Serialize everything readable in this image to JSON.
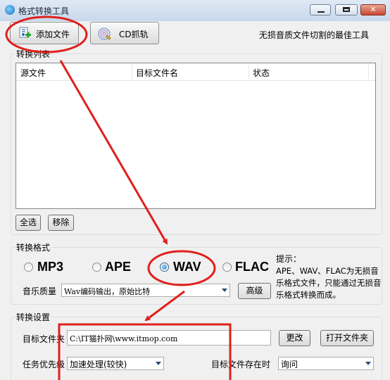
{
  "window": {
    "title": "格式转换工具",
    "min_glyph": "",
    "max_glyph": "",
    "close_glyph": "✕"
  },
  "toolbar": {
    "add_file_label": "添加文件",
    "cd_rip_label": "CD抓轨",
    "slogan": "无损音质文件切割的最佳工具"
  },
  "convert_list": {
    "group_label": "转换列表",
    "columns": [
      "源文件",
      "目标文件名",
      "状态"
    ],
    "select_all_label": "全选",
    "remove_label": "移除"
  },
  "convert_format": {
    "group_label": "转换格式",
    "formats": [
      {
        "label": "MP3",
        "checked": false
      },
      {
        "label": "APE",
        "checked": false
      },
      {
        "label": "WAV",
        "checked": true
      },
      {
        "label": "FLAC",
        "checked": false
      }
    ],
    "quality_label": "音乐质量",
    "quality_value": "Wav编码输出，原始比特",
    "advanced_label": "高级",
    "hint_title": "提示：",
    "hint_body": "APE、WAV、FLAC为无损音乐格式文件，只能通过无损音乐格式转换而成。"
  },
  "convert_settings": {
    "group_label": "转换设置",
    "target_folder_label": "目标文件夹",
    "target_folder_value": "C:\\IT猫扑网\\www.itmop.com",
    "change_label": "更改",
    "open_folder_label": "打开文件夹",
    "priority_label": "任务优先级",
    "priority_value": "加速处理(较快)",
    "exists_label": "目标文件存在时",
    "exists_value": "询问"
  },
  "colors": {
    "annotation_red": "#e0201c",
    "window_bg": "#f0f0f0"
  }
}
